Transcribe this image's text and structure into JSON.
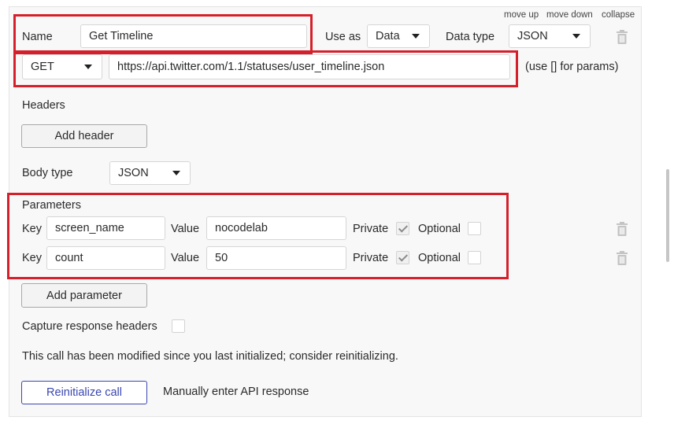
{
  "controls": {
    "move_up": "move up",
    "move_down": "move down",
    "collapse": "collapse"
  },
  "call": {
    "name_label": "Name",
    "name_value": "Get Timeline",
    "use_as_label": "Use as",
    "use_as_value": "Data",
    "data_type_label": "Data type",
    "data_type_value": "JSON",
    "method": "GET",
    "url": "https://api.twitter.com/1.1/statuses/user_timeline.json",
    "url_hint": "(use [] for params)"
  },
  "headers": {
    "label": "Headers",
    "add_button": "Add header"
  },
  "body_type": {
    "label": "Body type",
    "value": "JSON"
  },
  "parameters": {
    "label": "Parameters",
    "key_label": "Key",
    "value_label": "Value",
    "private_label": "Private",
    "optional_label": "Optional",
    "rows": [
      {
        "key": "screen_name",
        "value": "nocodelab",
        "private": true,
        "optional": false
      },
      {
        "key": "count",
        "value": "50",
        "private": true,
        "optional": false
      }
    ],
    "add_button": "Add parameter"
  },
  "capture": {
    "label": "Capture response headers",
    "checked": false
  },
  "notice": "This call has been modified since you last initialized; consider reinitializing.",
  "actions": {
    "reinit": "Reinitialize call",
    "manual": "Manually enter API response"
  },
  "colors": {
    "highlight": "#d5202b",
    "accent": "#3a46b0"
  }
}
